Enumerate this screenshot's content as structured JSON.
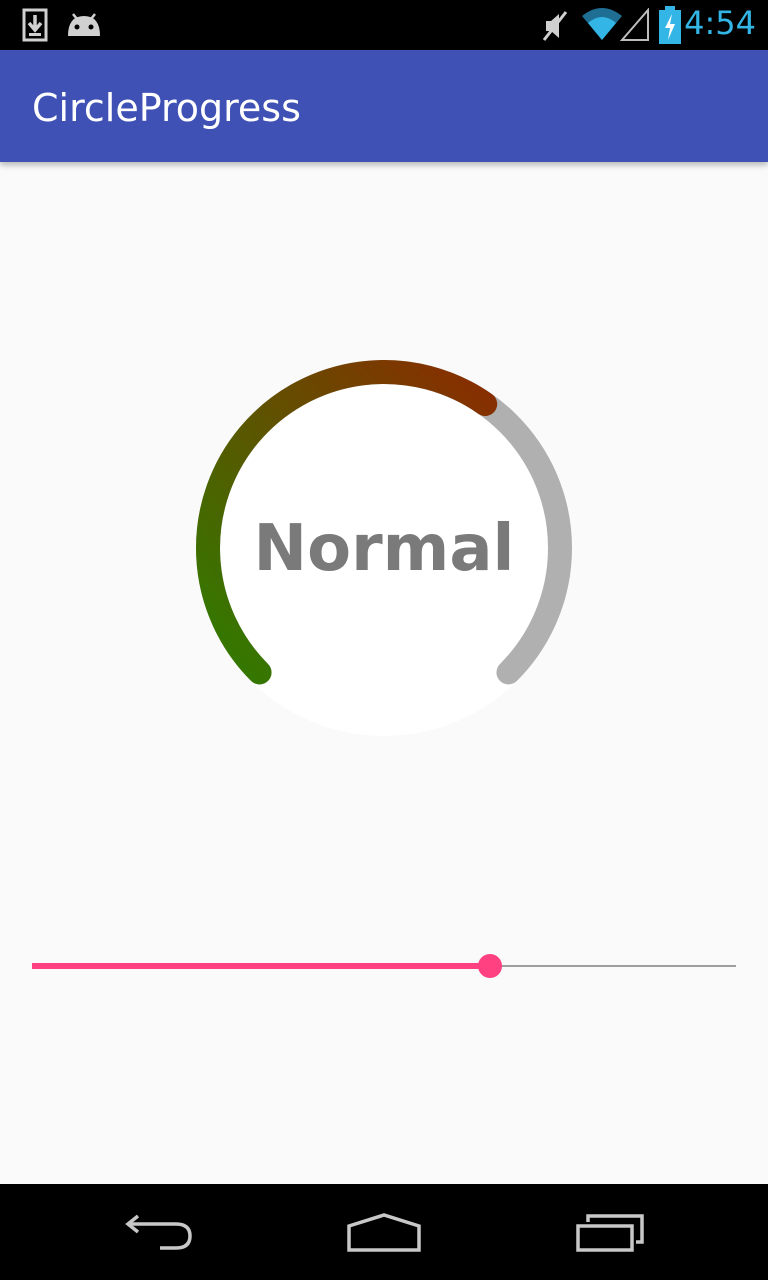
{
  "status_bar": {
    "time": "4:54",
    "icons": [
      "download-icon",
      "android-icon",
      "mute-icon",
      "wifi-icon",
      "signal-icon",
      "battery-charging-icon"
    ],
    "clock_color": "#33b5e5"
  },
  "app_bar": {
    "title": "CircleProgress",
    "color": "#3f51b5"
  },
  "gauge": {
    "label": "Normal",
    "progress": 0.63,
    "start_color": "#2e7d00",
    "end_color": "#8a2c00",
    "track_color": "#b0b0b0"
  },
  "slider": {
    "value": 0.65,
    "accent": "#ff4081"
  },
  "nav_bar": {
    "icons": [
      "back-icon",
      "home-icon",
      "recents-icon"
    ]
  }
}
